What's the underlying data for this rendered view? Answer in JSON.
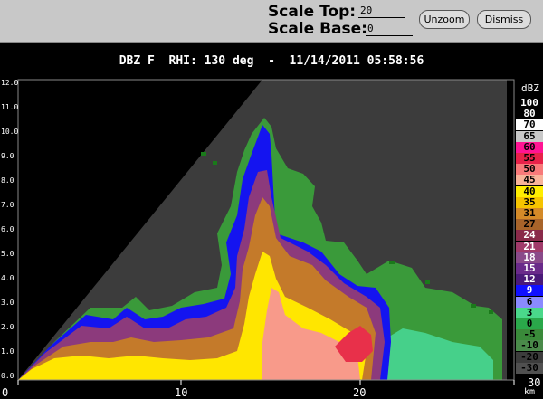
{
  "toolbar": {
    "scale_top_label": "Scale Top:",
    "scale_top_value": "20",
    "scale_base_label": "Scale Base:",
    "scale_base_value": "0",
    "unzoom_label": "Unzoom",
    "dismiss_label": "Dismiss"
  },
  "title": "DBZ F  RHI: 130 deg  -  11/14/2011 05:58:56",
  "axes": {
    "x_ticks": [
      "0",
      "10",
      "20",
      "30"
    ],
    "x_unit": "km",
    "y_ticks": [
      "0.0",
      "1.0",
      "2.0",
      "3.0",
      "4.0",
      "5.0",
      "6.0",
      "7.0",
      "8.0",
      "9.0",
      "10.0",
      "11.0",
      "12.0"
    ]
  },
  "legend": {
    "unit": "dBZ",
    "entries": [
      {
        "label": "100",
        "color": "#000000",
        "text": "#ffffff"
      },
      {
        "label": "80",
        "color": "#000000",
        "text": "#ffffff"
      },
      {
        "label": "70",
        "color": "#ffffff",
        "text": "#000000"
      },
      {
        "label": "65",
        "color": "#c8c8c8",
        "text": "#000000"
      },
      {
        "label": "60",
        "color": "#ff1493",
        "text": "#000000"
      },
      {
        "label": "55",
        "color": "#e8224a",
        "text": "#000000"
      },
      {
        "label": "50",
        "color": "#f87a7a",
        "text": "#000000"
      },
      {
        "label": "45",
        "color": "#f8b49a",
        "text": "#000000"
      },
      {
        "label": "40",
        "color": "#ffee00",
        "text": "#000000"
      },
      {
        "label": "35",
        "color": "#f6c400",
        "text": "#000000"
      },
      {
        "label": "31",
        "color": "#d48a28",
        "text": "#000000"
      },
      {
        "label": "27",
        "color": "#a8642a",
        "text": "#000000"
      },
      {
        "label": "24",
        "color": "#8a2a4a",
        "text": "#ffffff"
      },
      {
        "label": "21",
        "color": "#a03a6a",
        "text": "#ffffff"
      },
      {
        "label": "18",
        "color": "#8a4a8a",
        "text": "#ffffff"
      },
      {
        "label": "15",
        "color": "#6a2a8a",
        "text": "#ffffff"
      },
      {
        "label": "12",
        "color": "#4a1a78",
        "text": "#ffffff"
      },
      {
        "label": "9",
        "color": "#1010ff",
        "text": "#ffffff"
      },
      {
        "label": "6",
        "color": "#8a8aff",
        "text": "#000000"
      },
      {
        "label": "3",
        "color": "#4ad88a",
        "text": "#000000"
      },
      {
        "label": "0",
        "color": "#2aa84a",
        "text": "#000000"
      },
      {
        "label": "-5",
        "color": "#3a8a3a",
        "text": "#000000"
      },
      {
        "label": "-10",
        "color": "#4a8a4a",
        "text": "#000000"
      },
      {
        "label": "-20",
        "color": "#3c3c3c",
        "text": "#000000"
      },
      {
        "label": "-30",
        "color": "#505050",
        "text": "#000000"
      }
    ]
  }
}
